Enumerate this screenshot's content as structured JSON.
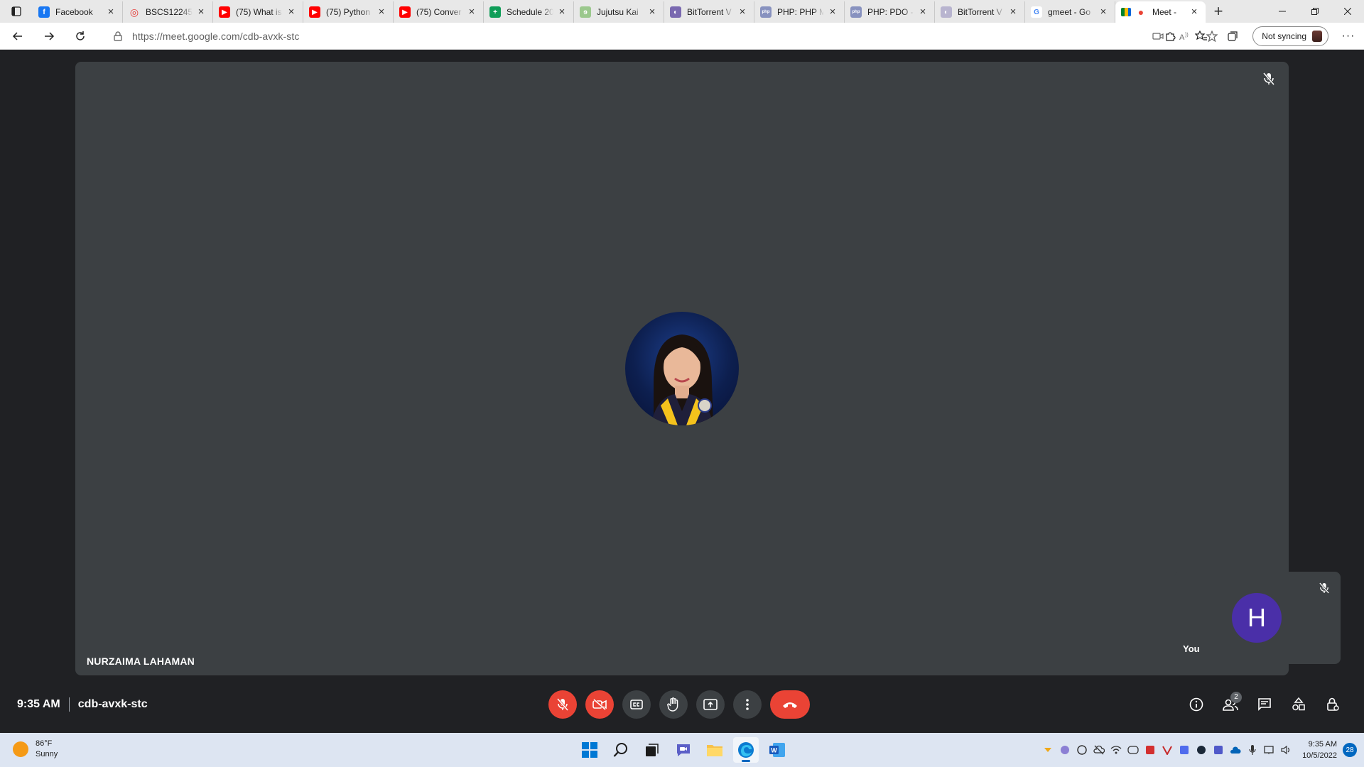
{
  "browser": {
    "tabs": [
      {
        "title": "Facebook",
        "icon": "facebook-icon",
        "color": "#1877f2",
        "glyph": "f"
      },
      {
        "title": "BSCS12245",
        "icon": "target-icon",
        "color": "#e53935",
        "glyph": "◎"
      },
      {
        "title": "(75) What is",
        "icon": "youtube-icon",
        "color": "#ff0000",
        "glyph": "▶"
      },
      {
        "title": "(75) Python",
        "icon": "youtube-icon",
        "color": "#ff0000",
        "glyph": "▶"
      },
      {
        "title": "(75) Conver",
        "icon": "youtube-icon",
        "color": "#ff0000",
        "glyph": "▶"
      },
      {
        "title": "Schedule 20",
        "icon": "sheets-icon",
        "color": "#0f9d58",
        "glyph": "+"
      },
      {
        "title": "Jujutsu Kai",
        "icon": "site-icon",
        "color": "#9bc88d",
        "glyph": "ɘ"
      },
      {
        "title": "BitTorrent V",
        "icon": "bittorrent-icon",
        "color": "#7a69b0",
        "glyph": "◐"
      },
      {
        "title": "PHP: PHP M",
        "icon": "php-icon",
        "color": "#8892bf",
        "glyph": "php"
      },
      {
        "title": "PHP: PDO -",
        "icon": "php-icon",
        "color": "#8892bf",
        "glyph": "php"
      },
      {
        "title": "BitTorrent V",
        "icon": "bittorrent-icon",
        "color": "#b8b4cf",
        "glyph": "◐"
      },
      {
        "title": "gmeet - Go",
        "icon": "google-icon",
        "color": "#4285f4",
        "glyph": "G"
      },
      {
        "title": "Meet -",
        "icon": "meet-icon",
        "color": "#ea4335",
        "glyph": "●",
        "active": true
      }
    ],
    "url": "https://meet.google.com/cdb-avxk-stc",
    "sync_label": "Not syncing"
  },
  "meet": {
    "participant_name": "NURZAIMA LAHAMAN",
    "self_initial": "H",
    "self_label": "You",
    "time": "9:35 AM",
    "meeting_code": "cdb-avxk-stc",
    "people_count": "2",
    "colors": {
      "stage": "#202124",
      "tile": "#3c4043",
      "danger": "#ea4335",
      "self_avatar": "#4a2fa8"
    }
  },
  "taskbar": {
    "temperature": "86°F",
    "condition": "Sunny",
    "clock_time": "9:35 AM",
    "clock_date": "10/5/2022",
    "notification_count": "28"
  }
}
